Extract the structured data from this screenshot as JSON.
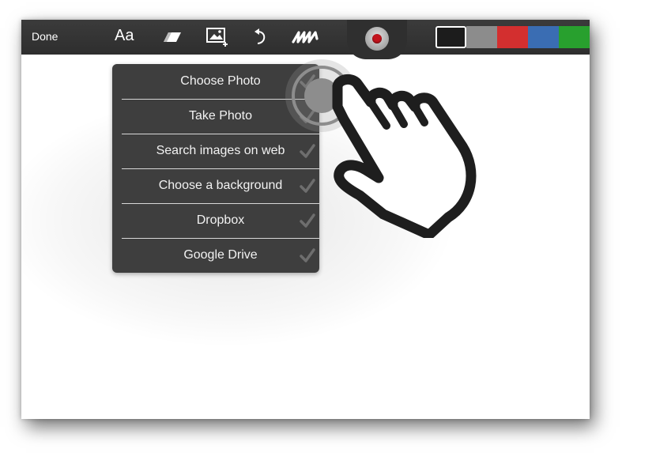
{
  "toolbar": {
    "done_label": "Done",
    "text_tool_label": "Aa",
    "icons": [
      "eraser-icon",
      "add-image-icon",
      "undo-icon",
      "scribble-icon",
      "record-icon"
    ],
    "colors": [
      "#1c1c1c",
      "#8c8c8c",
      "#d32f2f",
      "#3a6db3",
      "#28a02e"
    ],
    "selected_color": "#1c1c1c"
  },
  "photo_menu": {
    "items": [
      {
        "label": "Choose Photo"
      },
      {
        "label": "Take Photo"
      },
      {
        "label": "Search images on web"
      },
      {
        "label": "Choose a background"
      },
      {
        "label": "Dropbox"
      },
      {
        "label": "Google Drive"
      }
    ]
  }
}
